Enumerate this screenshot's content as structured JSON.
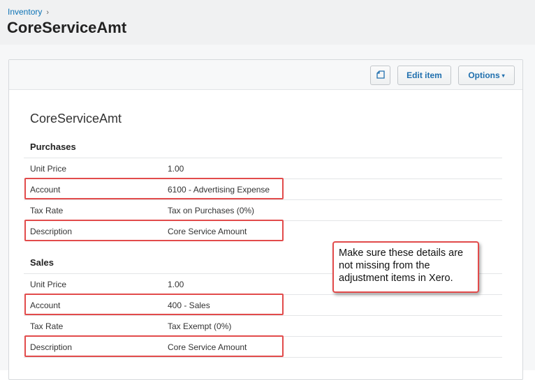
{
  "breadcrumb": {
    "parent": "Inventory",
    "separator": "›"
  },
  "page_title": "CoreServiceAmt",
  "toolbar": {
    "copy_icon": "copy-icon",
    "edit_label": "Edit item",
    "options_label": "Options",
    "options_caret": "▾"
  },
  "item": {
    "name": "CoreServiceAmt",
    "purchases": {
      "title": "Purchases",
      "rows": [
        {
          "label": "Unit Price",
          "value": "1.00"
        },
        {
          "label": "Account",
          "value": "6100 - Advertising Expense"
        },
        {
          "label": "Tax Rate",
          "value": "Tax on Purchases (0%)"
        },
        {
          "label": "Description",
          "value": "Core Service Amount"
        }
      ]
    },
    "sales": {
      "title": "Sales",
      "rows": [
        {
          "label": "Unit Price",
          "value": "1.00"
        },
        {
          "label": "Account",
          "value": "400 - Sales"
        },
        {
          "label": "Tax Rate",
          "value": "Tax Exempt (0%)"
        },
        {
          "label": "Description",
          "value": "Core Service Amount"
        }
      ]
    }
  },
  "callout": {
    "text": "Make sure these details are not missing from the adjustment items in Xero."
  },
  "colors": {
    "link": "#0b72b5",
    "highlight": "#e24b4b",
    "header_bg": "#f0f1f2"
  }
}
